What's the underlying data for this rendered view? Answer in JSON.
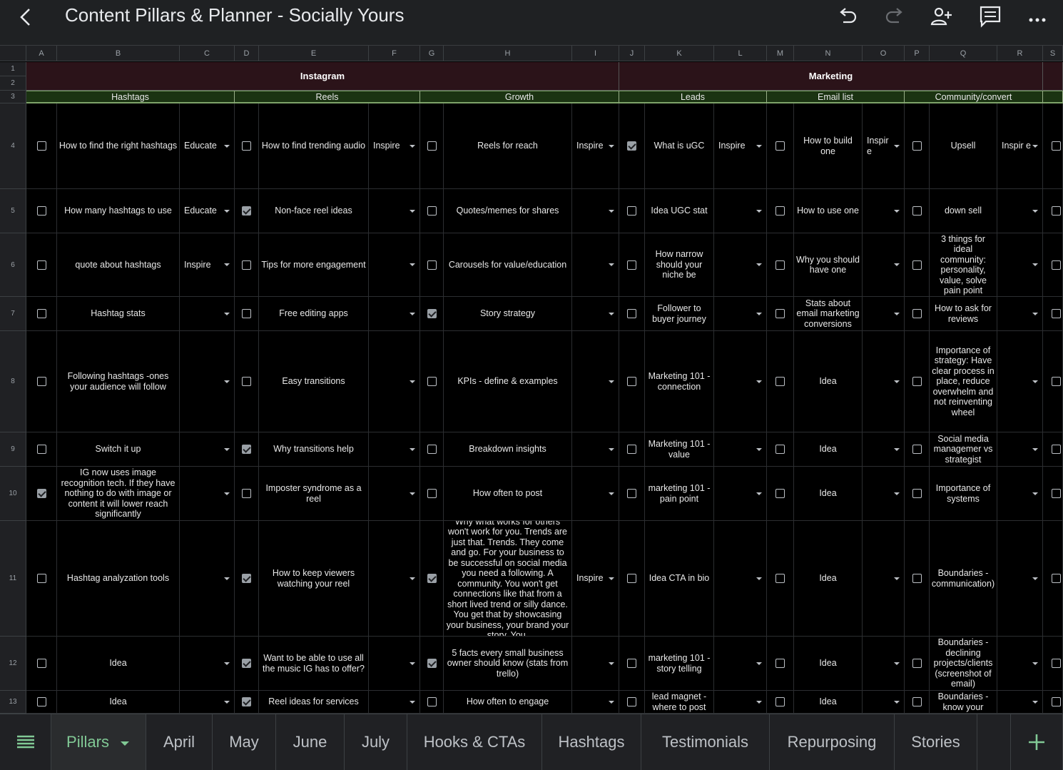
{
  "app": {
    "title": "Content Pillars & Planner - Socially Yours"
  },
  "toolbar": {
    "icons": [
      "back-icon",
      "undo-icon",
      "redo-icon",
      "add-person-icon",
      "comment-icon",
      "more-icon"
    ]
  },
  "columns": [
    "A",
    "B",
    "C",
    "D",
    "E",
    "F",
    "G",
    "H",
    "I",
    "J",
    "K",
    "L",
    "M",
    "N",
    "O",
    "P",
    "Q",
    "R",
    "S"
  ],
  "rows": [
    "1",
    "2",
    "3",
    "4",
    "5",
    "6",
    "7",
    "8",
    "9",
    "10",
    "11",
    "12",
    "13"
  ],
  "categories": {
    "instagram": "Instagram",
    "marketing": "Marketing"
  },
  "subheaders": {
    "hashtags": "Hashtags",
    "reels": "Reels",
    "growth": "Growth",
    "leads": "Leads",
    "email": "Email list",
    "community": "Community/convert"
  },
  "grid": [
    {
      "a": false,
      "b": "How to find the right hashtags",
      "c": "Educate",
      "d": false,
      "e": "How to find trending audio",
      "f": "Inspire",
      "g": false,
      "h": "Reels for reach",
      "i": "Inspire",
      "j": true,
      "k": "What is uGC",
      "l": "Inspire",
      "m": false,
      "n": "How to build one",
      "o": "Inspir e",
      "p": false,
      "q": "Upsell",
      "r": "Inspir e"
    },
    {
      "a": false,
      "b": "How many hashtags to use",
      "c": "Educate",
      "d": true,
      "e": "Non-face reel ideas",
      "f": "",
      "g": false,
      "h": "Quotes/memes for shares",
      "i": "",
      "j": false,
      "k": "Idea UGC stat",
      "l": "",
      "m": false,
      "n": "How to use one",
      "o": "",
      "p": false,
      "q": "down sell",
      "r": ""
    },
    {
      "a": false,
      "b": "quote about hashtags",
      "c": "Inspire",
      "d": false,
      "e": "Tips for more engagement",
      "f": "",
      "g": false,
      "h": "Carousels for value/education",
      "i": "",
      "j": false,
      "k": "How narrow should your niche be",
      "l": "",
      "m": false,
      "n": "Why you should have one",
      "o": "",
      "p": false,
      "q": "3 things for ideal community: personality, value, solve pain point",
      "r": ""
    },
    {
      "a": false,
      "b": "Hashtag stats",
      "c": "",
      "d": false,
      "e": "Free editing apps",
      "f": "",
      "g": true,
      "h": "Story strategy",
      "i": "",
      "j": false,
      "k": "Follower to buyer journey",
      "l": "",
      "m": false,
      "n": "Stats about email marketing conversions",
      "o": "",
      "p": false,
      "q": "How to ask for reviews",
      "r": ""
    },
    {
      "a": false,
      "b": "Following hashtags -ones your audience will follow",
      "c": "",
      "d": false,
      "e": "Easy transitions",
      "f": "",
      "g": false,
      "h": "KPIs - define & examples",
      "i": "",
      "j": false,
      "k": "Marketing 101 - connection",
      "l": "",
      "m": false,
      "n": "Idea",
      "o": "",
      "p": false,
      "q": "Importance of strategy: Have clear process in place, reduce overwhelm and not reinventing wheel",
      "r": ""
    },
    {
      "a": false,
      "b": "Switch it up",
      "c": "",
      "d": true,
      "e": "Why transitions help",
      "f": "",
      "g": false,
      "h": "Breakdown insights",
      "i": "",
      "j": false,
      "k": "Marketing 101 - value",
      "l": "",
      "m": false,
      "n": "Idea",
      "o": "",
      "p": false,
      "q": "Social media managemer vs strategist",
      "r": ""
    },
    {
      "a": true,
      "b": "IG now uses image recognition tech. If they have nothing to do with image or content it will lower reach significantly",
      "c": "",
      "d": false,
      "e": "Imposter syndrome as a reel",
      "f": "",
      "g": false,
      "h": "How often to post",
      "i": "",
      "j": false,
      "k": "marketing 101 - pain point",
      "l": "",
      "m": false,
      "n": "Idea",
      "o": "",
      "p": false,
      "q": "Importance of systems",
      "r": ""
    },
    {
      "a": false,
      "b": "Hashtag analyzation tools",
      "c": "",
      "d": true,
      "e": "How to keep viewers watching your reel",
      "f": "",
      "g": true,
      "h": "Why what works for others won't work for you. Trends are just that. Trends. They come and go. For your business to be successful on social media you need a following. A community. You won't get connections like that from a short lived trend or silly dance. You get that by showcasing your business, your brand your story. You.",
      "i": "Inspire",
      "j": false,
      "k": "Idea CTA in bio",
      "l": "",
      "m": false,
      "n": "Idea",
      "o": "",
      "p": false,
      "q": "Boundaries - communication)",
      "r": ""
    },
    {
      "a": false,
      "b": "Idea",
      "c": "",
      "d": true,
      "e": "Want to be able to use all the music IG has to offer?",
      "f": "",
      "g": true,
      "h": "5 facts every small business owner should know (stats from trello)",
      "i": "",
      "j": false,
      "k": "marketing 101 - story telling",
      "l": "",
      "m": false,
      "n": "Idea",
      "o": "",
      "p": false,
      "q": "Boundaries - declining projects/clients (screenshot of email)",
      "r": ""
    },
    {
      "a": false,
      "b": "Idea",
      "c": "",
      "d": true,
      "e": "Reel ideas for services",
      "f": "",
      "g": false,
      "h": "How often to engage",
      "i": "",
      "j": false,
      "k": "lead magnet - where to post",
      "l": "",
      "m": false,
      "n": "Idea",
      "o": "",
      "p": false,
      "q": "Boundaries - know your",
      "r": ""
    }
  ],
  "tabs": [
    "Pillars",
    "April",
    "May",
    "June",
    "July",
    "Hooks & CTAs",
    "Hashtags",
    "Testimonials",
    "Repurposing",
    "Stories"
  ],
  "active_tab": "Pillars"
}
